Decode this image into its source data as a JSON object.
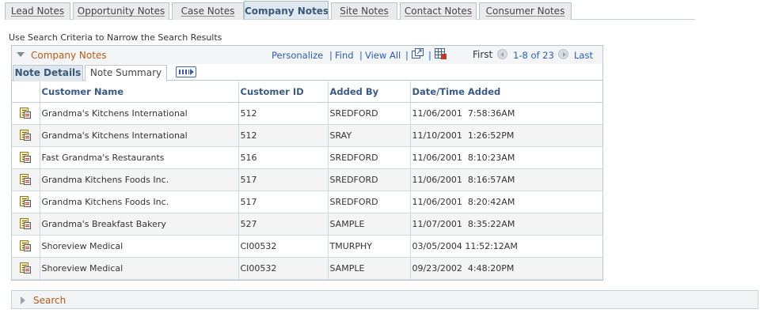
{
  "page_tabs": [
    {
      "label": "Lead Notes",
      "active": false
    },
    {
      "label": "Opportunity Notes",
      "active": false
    },
    {
      "label": "Case Notes",
      "active": false
    },
    {
      "label": "Company Notes",
      "active": true
    },
    {
      "label": "Site Notes",
      "active": false
    },
    {
      "label": "Contact Notes",
      "active": false
    },
    {
      "label": "Consumer Notes",
      "active": false
    }
  ],
  "instructions": "Use Search Criteria to Narrow the Search Results",
  "grid": {
    "title": "Company Notes",
    "nav": {
      "personalize": "Personalize",
      "find": "Find",
      "view_all": "View All",
      "first": "First",
      "range": "1-8 of 23",
      "last": "Last"
    },
    "sub_tabs": [
      {
        "label": "Note Details",
        "active": true
      },
      {
        "label": "Note Summary",
        "active": false
      }
    ],
    "columns": [
      "Customer Name",
      "Customer ID",
      "Added By",
      "Date/Time Added"
    ],
    "rows": [
      {
        "name": "Grandma's Kitchens International",
        "id": "512",
        "added_by": "SREDFORD",
        "datetime": "11/06/2001  7:58:36AM"
      },
      {
        "name": "Grandma's Kitchens International",
        "id": "512",
        "added_by": "SRAY",
        "datetime": "11/10/2001  1:26:52PM"
      },
      {
        "name": "Fast Grandma's Restaurants",
        "id": "516",
        "added_by": "SREDFORD",
        "datetime": "11/06/2001  8:10:23AM"
      },
      {
        "name": "Grandma Kitchens Foods Inc.",
        "id": "517",
        "added_by": "SREDFORD",
        "datetime": "11/06/2001  8:16:57AM"
      },
      {
        "name": "Grandma Kitchens Foods Inc.",
        "id": "517",
        "added_by": "SREDFORD",
        "datetime": "11/06/2001  8:20:42AM"
      },
      {
        "name": "Grandma's Breakfast Bakery",
        "id": "527",
        "added_by": "SAMPLE",
        "datetime": "11/07/2001  8:35:22AM"
      },
      {
        "name": "Shoreview Medical",
        "id": "CI00532",
        "added_by": "TMURPHY",
        "datetime": "03/05/2004 11:52:12AM"
      },
      {
        "name": "Shoreview Medical",
        "id": "CI00532",
        "added_by": "SAMPLE",
        "datetime": "09/23/2002  4:48:20PM"
      }
    ]
  },
  "search": {
    "label": "Search"
  },
  "colors": {
    "accent_orange": "#b35b1b",
    "link_blue": "#2a5db0",
    "header_blue": "#3a5a84"
  },
  "icons": [
    "collapse-triangle-icon",
    "new-window-icon",
    "download-grid-icon",
    "previous-icon",
    "next-icon",
    "expand-tabs-icon",
    "note-icon",
    "expand-triangle-icon"
  ]
}
